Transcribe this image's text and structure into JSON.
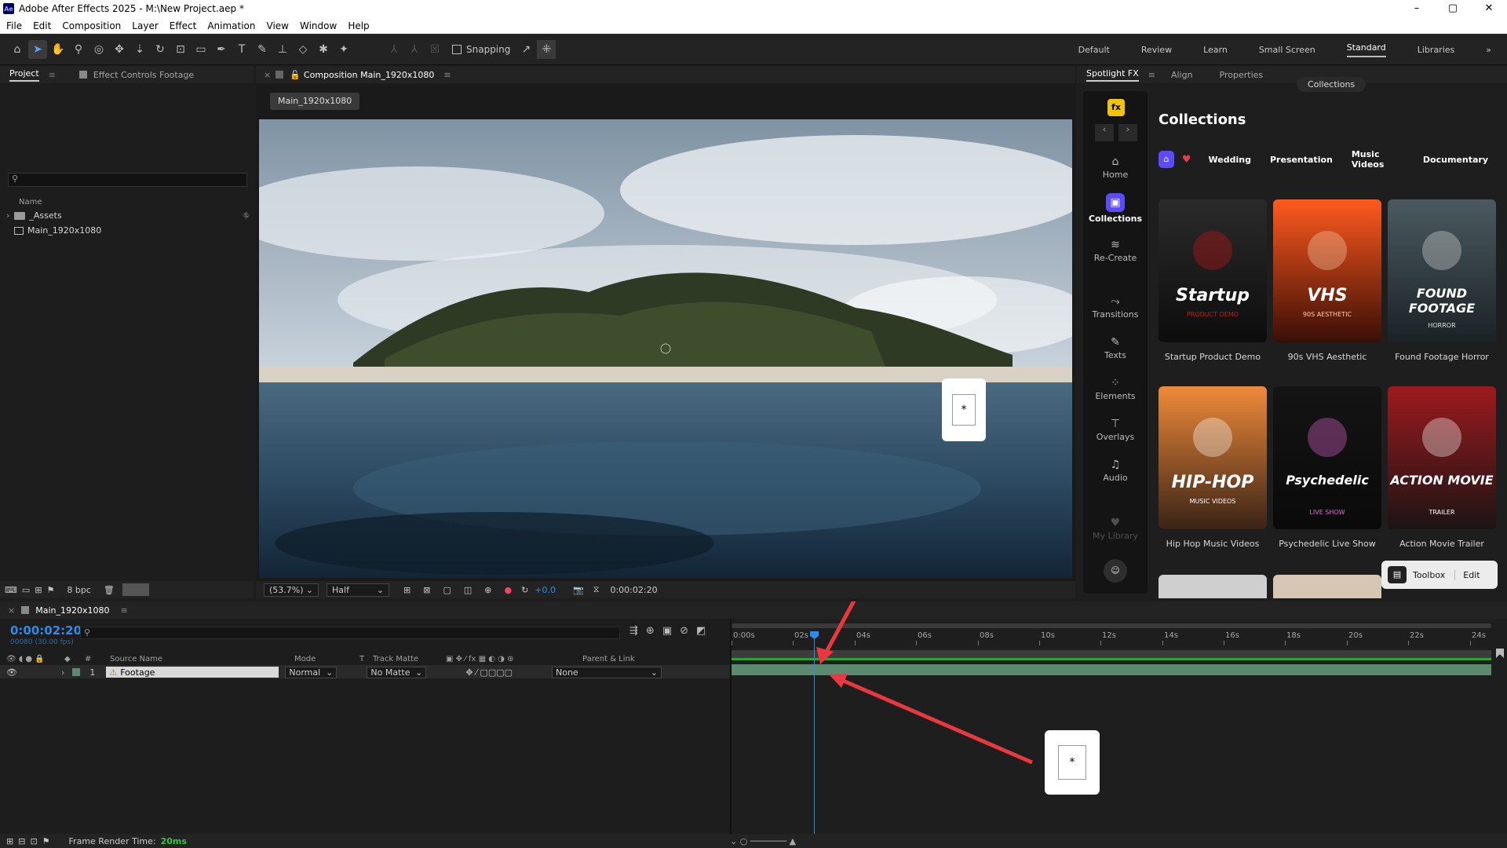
{
  "window": {
    "app_badge": "Ae",
    "title": "Adobe After Effects 2025 - M:\\New Project.aep *",
    "controls": [
      "–",
      "▢",
      "✕"
    ]
  },
  "menu": [
    "File",
    "Edit",
    "Composition",
    "Layer",
    "Effect",
    "Animation",
    "View",
    "Window",
    "Help"
  ],
  "toolbar": {
    "snapping_label": "Snapping",
    "workspaces": [
      "Default",
      "Review",
      "Learn",
      "Small Screen",
      "Standard",
      "Libraries"
    ],
    "active_workspace": "Standard",
    "overflow": "»"
  },
  "project_panel": {
    "tab_project": "Project",
    "tab_effect_controls": "Effect Controls Footage",
    "search_placeholder": "",
    "search_glyph": "⚲",
    "col_name": "Name",
    "items": [
      {
        "name": "_Assets",
        "type": "folder"
      },
      {
        "name": "Main_1920x1080",
        "type": "composition"
      }
    ],
    "bpc": "8 bpc"
  },
  "composition_panel": {
    "tab_title": "Composition Main_1920x1080",
    "comp_chip": "Main_1920x1080",
    "zoom": "(53.7%)",
    "resolution": "Half",
    "exposure": "+0.0",
    "timecode": "0:00:02:20"
  },
  "spotlight": {
    "tabs": [
      "Spotlight FX",
      "Align",
      "Properties"
    ],
    "collections_pill": "Collections",
    "heading": "Collections",
    "categories": [
      "Wedding",
      "Presentation",
      "Music Videos",
      "Documentary"
    ],
    "nav": [
      {
        "label": "Home",
        "icon": "⌂"
      },
      {
        "label": "Collections",
        "icon": "▣",
        "active": true
      },
      {
        "label": "Re-Create",
        "icon": "≋"
      },
      {
        "label": "Transitions",
        "icon": "⤳"
      },
      {
        "label": "Texts",
        "icon": "✎"
      },
      {
        "label": "Elements",
        "icon": "⁘"
      },
      {
        "label": "Overlays",
        "icon": "⊤"
      },
      {
        "label": "Audio",
        "icon": "♫"
      },
      {
        "label": "My Library",
        "icon": "♥"
      }
    ],
    "fx_badge": "fx",
    "cards": [
      {
        "label": "Startup Product Demo",
        "art_title": "Startup",
        "art_sub": "PRODUCT DEMO",
        "bg1": "#2a2a2a",
        "bg2": "#0d0d0d",
        "accent": "#d01515"
      },
      {
        "label": "90s VHS Aesthetic",
        "art_title": "VHS",
        "art_sub": "90S AESTHETIC",
        "bg1": "#ff5a1e",
        "bg2": "#3a0e06",
        "accent": "#ffd2b0"
      },
      {
        "label": "Found Footage Horror",
        "art_title": "FOUND FOOTAGE",
        "art_sub": "HORROR",
        "bg1": "#4a5a60",
        "bg2": "#1b2226",
        "accent": "#e0e0e0"
      },
      {
        "label": "Hip Hop Music Videos",
        "art_title": "HIP-HOP",
        "art_sub": "MUSIC VIDEOS",
        "bg1": "#f08a3a",
        "bg2": "#3a2316",
        "accent": "#ffffff"
      },
      {
        "label": "Psychedelic Live Show",
        "art_title": "Psychedelic",
        "art_sub": "LIVE SHOW",
        "bg1": "#141414",
        "bg2": "#0a0a0a",
        "accent": "#e86ad8"
      },
      {
        "label": "Action Movie Trailer",
        "art_title": "ACTION MOVIE",
        "art_sub": "TRAILER",
        "bg1": "#9c1a1e",
        "bg2": "#1c1414",
        "accent": "#ffffff"
      }
    ],
    "toolbox": {
      "label": "Toolbox",
      "edit": "Edit"
    }
  },
  "timeline": {
    "comp_tab": "Main_1920x1080",
    "timecode": "0:00:02:20",
    "frames": "00080 (30.00 fps)",
    "search_glyph": "⚲",
    "columns": {
      "num": "#",
      "source_name": "Source Name",
      "mode": "Mode",
      "t": "T",
      "track_matte": "Track Matte",
      "parent": "Parent & Link"
    },
    "layer": {
      "num": "1",
      "name": "Footage",
      "mode": "Normal",
      "matte": "No Matte",
      "parent": "None"
    },
    "ruler": [
      "0:00s",
      "02s",
      "04s",
      "06s",
      "08s",
      "10s",
      "12s",
      "14s",
      "16s",
      "18s",
      "20s",
      "22s",
      "24s"
    ],
    "playhead_seconds": 2.67,
    "render_time_label": "Frame Render Time:",
    "render_time_value": "20ms"
  },
  "annotations": [
    {
      "label": "*"
    },
    {
      "label": "*"
    }
  ],
  "colors": {
    "accent_blue": "#2d8ceb",
    "arrow_red": "#e8393f",
    "layer_bar": "#5b8a6e",
    "spotlight_purple": "#5b4bff",
    "fx_yellow": "#f2c500"
  }
}
